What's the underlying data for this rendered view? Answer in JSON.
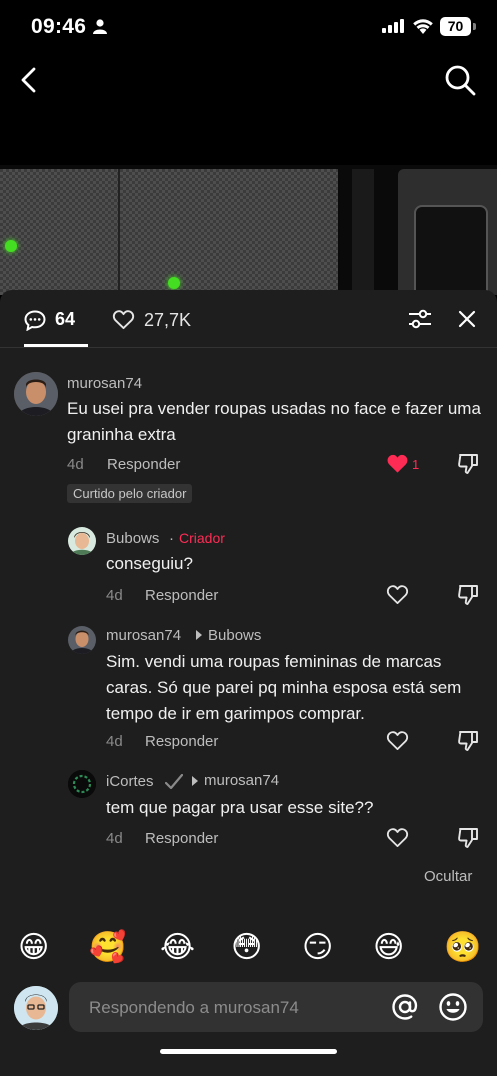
{
  "status": {
    "time": "09:46",
    "battery": "70"
  },
  "tabs": {
    "comments_count": "64",
    "likes_count": "27,7K"
  },
  "comments": [
    {
      "username": "murosan74",
      "text": "Eu usei pra vender roupas usadas no face e fazer uma graninha extra",
      "age": "4d",
      "reply_label": "Responder",
      "likes": "1",
      "badge": "Curtido pelo criador"
    },
    {
      "username": "Bubows",
      "separator": "·",
      "creator_label": "Criador",
      "text": "conseguiu?",
      "age": "4d",
      "reply_label": "Responder"
    },
    {
      "username": "murosan74",
      "reply_to": "Bubows",
      "text": "Sim. vendi uma roupas femininas de marcas caras. Só que parei pq minha esposa está sem tempo de ir em garimpos comprar.",
      "age": "4d",
      "reply_label": "Responder"
    },
    {
      "username": "iCortes",
      "reply_to": "murosan74",
      "text": "tem que pagar pra usar esse site??",
      "age": "4d",
      "reply_label": "Responder"
    }
  ],
  "hide_label": "Ocultar",
  "emojis": [
    "😁",
    "🥰",
    "😂",
    "😳",
    "😏",
    "😅",
    "🥺"
  ],
  "input": {
    "placeholder": "Respondendo a murosan74"
  },
  "colors": {
    "accent": "#fe2c55",
    "sheet_bg": "#1e1e1e"
  }
}
